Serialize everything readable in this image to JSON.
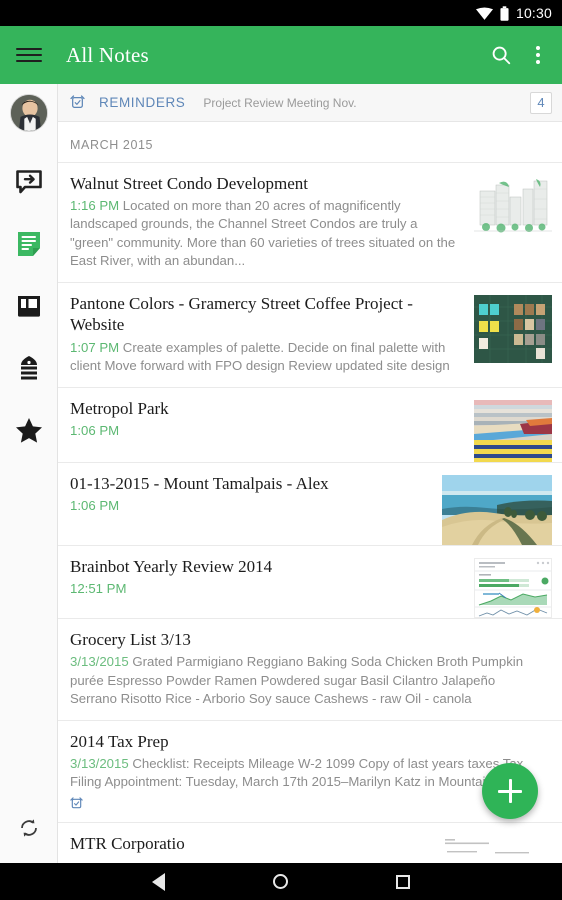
{
  "statusbar": {
    "time": "10:30",
    "wifi_icon": "wifi-icon",
    "battery_icon": "battery-icon"
  },
  "appbar": {
    "menu_icon": "hamburger-menu-icon",
    "title": "All Notes",
    "search_icon": "search-icon",
    "overflow_icon": "overflow-menu-icon",
    "background_color": "#35b45b"
  },
  "rail": {
    "avatar_name": "user-avatar",
    "items": [
      {
        "name": "sidebar-item-new-note",
        "icon": "new-note-icon",
        "active": false
      },
      {
        "name": "sidebar-item-notes",
        "icon": "notes-icon",
        "active": true
      },
      {
        "name": "sidebar-item-notebooks",
        "icon": "notebook-icon",
        "active": false
      },
      {
        "name": "sidebar-item-tags",
        "icon": "tag-icon",
        "active": false
      },
      {
        "name": "sidebar-item-shortcuts",
        "icon": "star-icon",
        "active": false
      }
    ],
    "sync_icon": "sync-icon"
  },
  "reminders": {
    "icon": "alarm-clock-icon",
    "label": "REMINDERS",
    "subtitle": "Project Review Meeting Nov.",
    "count": "4",
    "accent_color": "#5f87b8"
  },
  "list": {
    "month_header": "MARCH 2015",
    "notes": [
      {
        "title": "Walnut Street Condo Development",
        "time": "1:16 PM",
        "snippet": "Located on more than 20 acres of magnificently landscaped grounds, the Channel Street Condos are truly a \"green\" community. More than 60 varieties of trees situated on the East River, with an abundan...",
        "thumb": "condo-rendering-thumbnail",
        "has_reminder": false
      },
      {
        "title": "Pantone Colors - Gramercy Street Coffee Project - Website",
        "time": "1:07 PM",
        "snippet": "Create examples of palette. Decide on final palette with client Move forward with FPO design Review updated site design",
        "thumb": "pantone-swatches-thumbnail",
        "has_reminder": false
      },
      {
        "title": "Metropol Park",
        "time": "1:06 PM",
        "snippet": "",
        "thumb": "park-chairs-thumbnail",
        "has_reminder": false
      },
      {
        "title": "01-13-2015 - Mount Tamalpais - Alex",
        "time": "1:06 PM",
        "snippet": "",
        "thumb": "mountain-landscape-thumbnail",
        "has_reminder": false
      },
      {
        "title": "Brainbot Yearly Review 2014",
        "time": "12:51 PM",
        "snippet": "",
        "thumb": "dashboard-chart-thumbnail",
        "has_reminder": false
      },
      {
        "title": "Grocery List 3/13",
        "time": "3/13/2015",
        "snippet": "Grated Parmigiano Reggiano  Baking Soda  Chicken Broth  Pumpkin purée  Espresso Powder  Ramen  Powdered sugar  Basil  Cilantro  Jalapeño  Serrano  Risotto Rice - Arborio  Soy sauce  Cashews - raw  Oil - canola",
        "thumb": "",
        "has_reminder": false
      },
      {
        "title": "2014 Tax Prep",
        "time": "3/13/2015",
        "snippet": "Checklist:  Receipts  Mileage  W-2  1099  Copy of last years taxes   Tax Filing Appointment: Tuesday, March 17th 2015–Marilyn Katz in Mountain View",
        "thumb": "",
        "has_reminder": true
      },
      {
        "title": "MTR Corporatio",
        "time": "",
        "snippet": "",
        "thumb": "document-scan-thumbnail",
        "has_reminder": false
      }
    ]
  },
  "fab": {
    "name": "new-note-fab",
    "icon": "plus-icon",
    "color": "#2fb457"
  },
  "navbar": {
    "back_icon": "back-triangle-icon",
    "home_icon": "home-circle-icon",
    "recents_icon": "recents-square-icon"
  }
}
